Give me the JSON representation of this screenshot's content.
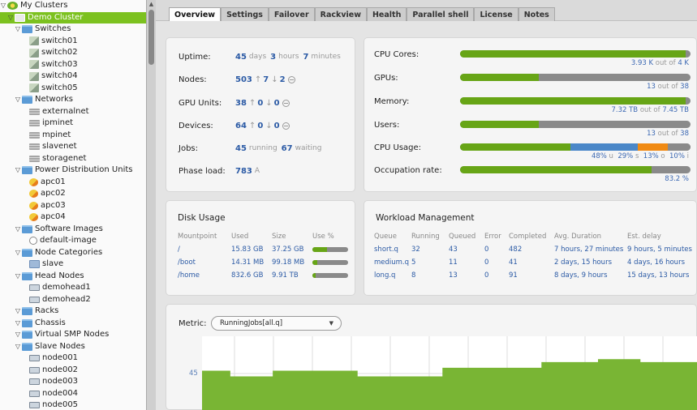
{
  "tree": [
    {
      "label": "My Clusters",
      "indent": 0,
      "icon": "root",
      "toggle": "open"
    },
    {
      "label": "Demo Cluster",
      "indent": 1,
      "icon": "cluster",
      "toggle": "open",
      "selected": true
    },
    {
      "label": "Switches",
      "indent": 2,
      "icon": "folder",
      "toggle": "open"
    },
    {
      "label": "switch01",
      "indent": 3,
      "icon": "switch"
    },
    {
      "label": "switch02",
      "indent": 3,
      "icon": "switch"
    },
    {
      "label": "switch03",
      "indent": 3,
      "icon": "switch"
    },
    {
      "label": "switch04",
      "indent": 3,
      "icon": "switch"
    },
    {
      "label": "switch05",
      "indent": 3,
      "icon": "switch"
    },
    {
      "label": "Networks",
      "indent": 2,
      "icon": "folder",
      "toggle": "open"
    },
    {
      "label": "externalnet",
      "indent": 3,
      "icon": "net"
    },
    {
      "label": "ipminet",
      "indent": 3,
      "icon": "net"
    },
    {
      "label": "mpinet",
      "indent": 3,
      "icon": "net"
    },
    {
      "label": "slavenet",
      "indent": 3,
      "icon": "net"
    },
    {
      "label": "storagenet",
      "indent": 3,
      "icon": "net"
    },
    {
      "label": "Power Distribution Units",
      "indent": 2,
      "icon": "folder",
      "toggle": "open"
    },
    {
      "label": "apc01",
      "indent": 3,
      "icon": "pdu"
    },
    {
      "label": "apc02",
      "indent": 3,
      "icon": "pdu"
    },
    {
      "label": "apc03",
      "indent": 3,
      "icon": "pdu"
    },
    {
      "label": "apc04",
      "indent": 3,
      "icon": "pdu"
    },
    {
      "label": "Software Images",
      "indent": 2,
      "icon": "folder",
      "toggle": "open"
    },
    {
      "label": "default-image",
      "indent": 3,
      "icon": "image"
    },
    {
      "label": "Node Categories",
      "indent": 2,
      "icon": "folder",
      "toggle": "open"
    },
    {
      "label": "slave",
      "indent": 3,
      "icon": "cat"
    },
    {
      "label": "Head Nodes",
      "indent": 2,
      "icon": "folder",
      "toggle": "open"
    },
    {
      "label": "demohead1",
      "indent": 3,
      "icon": "host"
    },
    {
      "label": "demohead2",
      "indent": 3,
      "icon": "host"
    },
    {
      "label": "Racks",
      "indent": 2,
      "icon": "folder",
      "toggle": "open"
    },
    {
      "label": "Chassis",
      "indent": 2,
      "icon": "folder",
      "toggle": "open"
    },
    {
      "label": "Virtual SMP Nodes",
      "indent": 2,
      "icon": "folder",
      "toggle": "open"
    },
    {
      "label": "Slave Nodes",
      "indent": 2,
      "icon": "folder",
      "toggle": "open"
    },
    {
      "label": "node001",
      "indent": 3,
      "icon": "host"
    },
    {
      "label": "node002",
      "indent": 3,
      "icon": "host"
    },
    {
      "label": "node003",
      "indent": 3,
      "icon": "host"
    },
    {
      "label": "node004",
      "indent": 3,
      "icon": "host"
    },
    {
      "label": "node005",
      "indent": 3,
      "icon": "host"
    }
  ],
  "tabs": [
    "Overview",
    "Settings",
    "Failover",
    "Rackview",
    "Health",
    "Parallel shell",
    "License",
    "Notes"
  ],
  "stats": {
    "uptime": {
      "label": "Uptime:",
      "days": "45",
      "days_unit": "days",
      "hours": "3",
      "hours_unit": "hours",
      "minutes": "7",
      "minutes_unit": "minutes"
    },
    "nodes": {
      "label": "Nodes:",
      "total": "503",
      "up": "7",
      "down": "2"
    },
    "gpu_units": {
      "label": "GPU Units:",
      "total": "38",
      "up": "0",
      "down": "0"
    },
    "devices": {
      "label": "Devices:",
      "total": "64",
      "up": "0",
      "down": "0"
    },
    "jobs": {
      "label": "Jobs:",
      "running": "45",
      "running_unit": "running",
      "waiting": "67",
      "waiting_unit": "waiting"
    },
    "phase_load": {
      "label": "Phase load:",
      "value": "783",
      "unit": "A"
    }
  },
  "resources": {
    "cpu_cores": {
      "label": "CPU Cores:",
      "used": "3.93 K",
      "of": "out of",
      "total": "4 K",
      "fraction": 0.98
    },
    "gpus": {
      "label": "GPUs:",
      "used": "13",
      "of": "out of",
      "total": "38",
      "fraction": 0.34
    },
    "memory": {
      "label": "Memory:",
      "used": "7.32 TB",
      "of": "out of",
      "total": "7.45 TB",
      "fraction": 0.98
    },
    "users": {
      "label": "Users:",
      "used": "13",
      "of": "out of",
      "total": "38",
      "fraction": 0.34
    },
    "cpu_usage": {
      "label": "CPU Usage:",
      "user": "48%",
      "user_unit": "u",
      "system": "29%",
      "system_unit": "s",
      "other": "13%",
      "other_unit": "o",
      "idle": "10%",
      "idle_unit": "i",
      "fractions": [
        0.48,
        0.29,
        0.13,
        0.1
      ],
      "colors": [
        "#67a516",
        "#4a87c8",
        "#f08a13",
        "#8a8a8a"
      ]
    },
    "occupation": {
      "label": "Occupation rate:",
      "value": "83.2 %",
      "fraction": 0.832
    }
  },
  "disk": {
    "title": "Disk Usage",
    "headers": [
      "Mountpoint",
      "Used",
      "Size",
      "Use %"
    ],
    "rows": [
      {
        "mount": "/",
        "used": "15.83 GB",
        "size": "37.25 GB",
        "pct": 0.42
      },
      {
        "mount": "/boot",
        "used": "14.31 MB",
        "size": "99.18 MB",
        "pct": 0.14
      },
      {
        "mount": "/home",
        "used": "832.6 GB",
        "size": "9.91 TB",
        "pct": 0.08
      }
    ]
  },
  "wlm": {
    "title": "Workload Management",
    "headers": [
      "Queue",
      "Running",
      "Queued",
      "Error",
      "Completed",
      "Avg. Duration",
      "Est. delay"
    ],
    "rows": [
      [
        "short.q",
        "32",
        "43",
        "0",
        "482",
        "7 hours, 27 minutes",
        "9 hours, 5 minutes"
      ],
      [
        "medium.q",
        "5",
        "11",
        "0",
        "41",
        "2 days, 15 hours",
        "4 days, 16 hours"
      ],
      [
        "long.q",
        "8",
        "13",
        "0",
        "91",
        "8 days, 9 hours",
        "15 days, 13 hours"
      ]
    ]
  },
  "metric": {
    "label": "Metric:",
    "selected": "RunningJobs[all.q]",
    "ytick": "45",
    "series": [
      44,
      44,
      42,
      42,
      42,
      44,
      44,
      44,
      44,
      44,
      44,
      42,
      42,
      42,
      42,
      42,
      42,
      45,
      45,
      45,
      45,
      45,
      45,
      45,
      47,
      47,
      47,
      47,
      48,
      48,
      48,
      47,
      47,
      47,
      47
    ]
  },
  "colors": {
    "accent": "#7cc11f",
    "bar_green": "#67a516",
    "link": "#2b5aa5"
  }
}
